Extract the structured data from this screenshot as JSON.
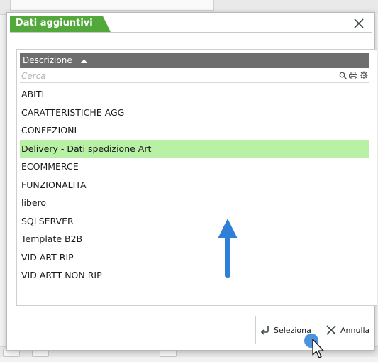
{
  "dialog": {
    "title": "Dati aggiuntivi",
    "list": {
      "column_header": "Descrizione",
      "search_placeholder": "Cerca",
      "items": [
        "ABITI",
        "CARATTERISTICHE AGG",
        "CONFEZIONI",
        "Delivery - Dati spedizione Art",
        "ECOMMERCE",
        "FUNZIONALITA",
        "libero",
        "SQLSERVER",
        "Template B2B",
        "VID ART RIP",
        "VID ARTT NON RIP"
      ],
      "selected_item": "Delivery - Dati spedizione Art"
    },
    "footer": {
      "select_label": "Seleziona",
      "cancel_label": "Annulla"
    }
  },
  "colors": {
    "title_tab": "#52a83a",
    "header_bg": "#6e6e6e",
    "selected_row": "#b8f0a6",
    "arrow": "#2f7fd6"
  },
  "icons": [
    "close-icon",
    "sort-asc-icon",
    "search-icon",
    "print-icon",
    "settings-icon",
    "select-return-icon",
    "cancel-x-icon",
    "arrow-up-icon",
    "mouse-cursor-icon"
  ]
}
